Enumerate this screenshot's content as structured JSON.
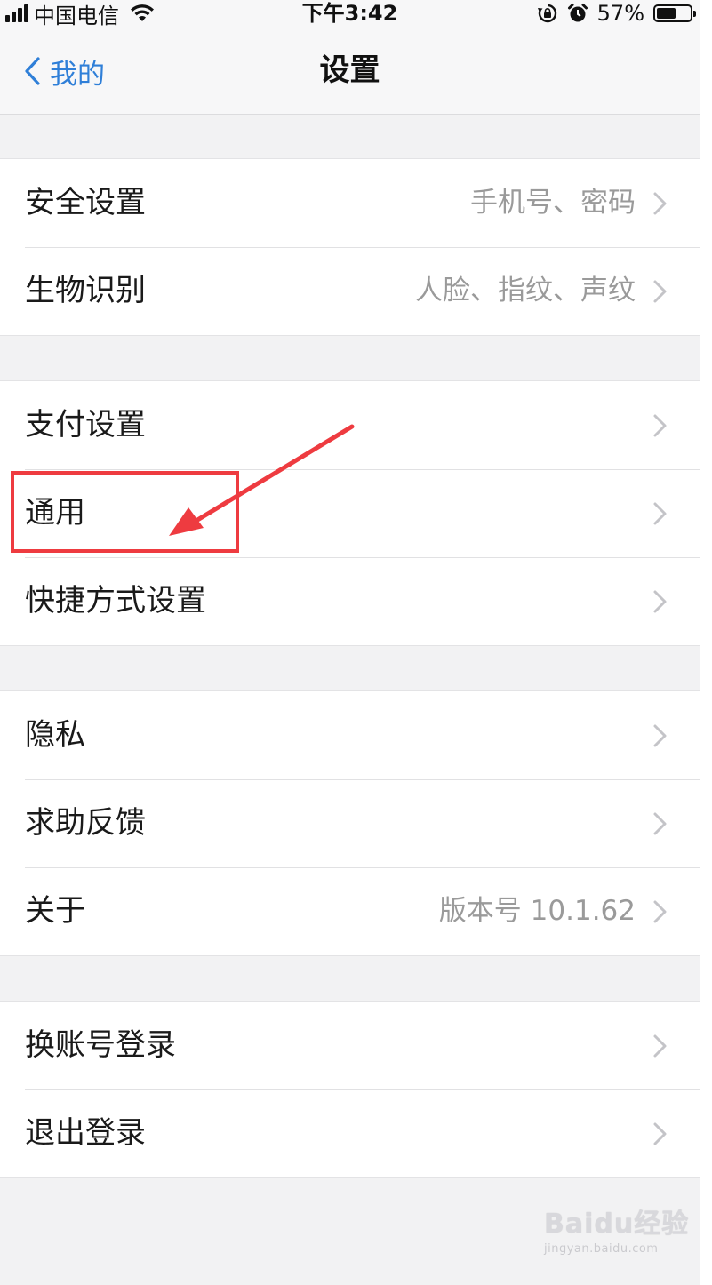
{
  "status_bar": {
    "carrier": "中国电信",
    "time": "下午3:42",
    "battery_percent": "57%",
    "battery_level": 0.57,
    "icons": [
      "signal-icon",
      "wifi-icon",
      "rotation-lock-icon",
      "alarm-icon",
      "battery-icon"
    ]
  },
  "nav": {
    "back_label": "我的",
    "title": "设置"
  },
  "groups": [
    {
      "rows": [
        {
          "label": "安全设置",
          "detail": "手机号、密码"
        },
        {
          "label": "生物识别",
          "detail": "人脸、指纹、声纹"
        }
      ]
    },
    {
      "rows": [
        {
          "label": "支付设置",
          "detail": ""
        },
        {
          "label": "通用",
          "detail": ""
        },
        {
          "label": "快捷方式设置",
          "detail": ""
        }
      ]
    },
    {
      "rows": [
        {
          "label": "隐私",
          "detail": ""
        },
        {
          "label": "求助反馈",
          "detail": ""
        },
        {
          "label": "关于",
          "detail": "版本号 10.1.62"
        }
      ]
    },
    {
      "rows": [
        {
          "label": "换账号登录",
          "detail": ""
        },
        {
          "label": "退出登录",
          "detail": ""
        }
      ]
    }
  ],
  "annotation": {
    "highlighted_item": "通用",
    "color": "#ee3b40"
  },
  "watermark": {
    "logo": "Baidu经验",
    "url": "jingyan.baidu.com"
  },
  "colors": {
    "accent": "#2f7fd8",
    "background": "#f2f2f3",
    "detail_text": "#9a9a9a",
    "annotation": "#ee3b40"
  }
}
